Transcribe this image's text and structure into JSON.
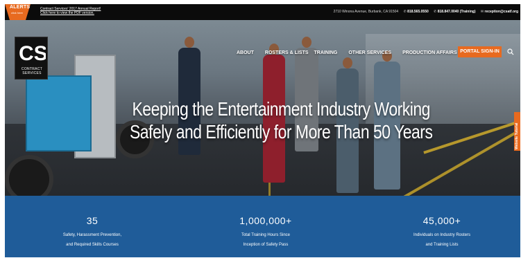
{
  "topbar": {
    "alerts_title": "ALERTS",
    "alerts_sub": "click here",
    "report_line1": "Contract Services' 2017 Annual Report!",
    "report_line2": "Click here to view the PDF version.",
    "address": "2710 Winona Avenue, Burbank, CA 91504",
    "phone_main": "818.565.0550",
    "phone_training": "818.847.0040 (Training)",
    "email": "reception@csatf.org"
  },
  "logo": {
    "mark": "CS",
    "line1": "CONTRACT",
    "line2": "SERVICES"
  },
  "nav": {
    "items": [
      "ABOUT",
      "ROSTERS & LISTS",
      "TRAINING",
      "OTHER SERVICES",
      "PRODUCTION AFFAIRS & SAFETY"
    ],
    "portal_label": "PORTAL SIGN-IN"
  },
  "hero": {
    "headline_line1": "Keeping the Entertainment Industry Working",
    "headline_line2": "Safely and Efficiently for More Than 50 Years",
    "side_tab": "Website Tutorial"
  },
  "stats": [
    {
      "number": "35",
      "desc_line1": "Safety, Harassment Prevention,",
      "desc_line2": "and Required Skills Courses"
    },
    {
      "number": "1,000,000+",
      "desc_line1": "Total Training Hours Since",
      "desc_line2": "Inception of Safety Pass"
    },
    {
      "number": "45,000+",
      "desc_line1": "Individuals on Industry Rosters",
      "desc_line2": "and Training Lists"
    }
  ],
  "colors": {
    "accent": "#e86a1f",
    "stats_bg": "#1f5c99",
    "topbar_bg": "#0b0b0b"
  }
}
